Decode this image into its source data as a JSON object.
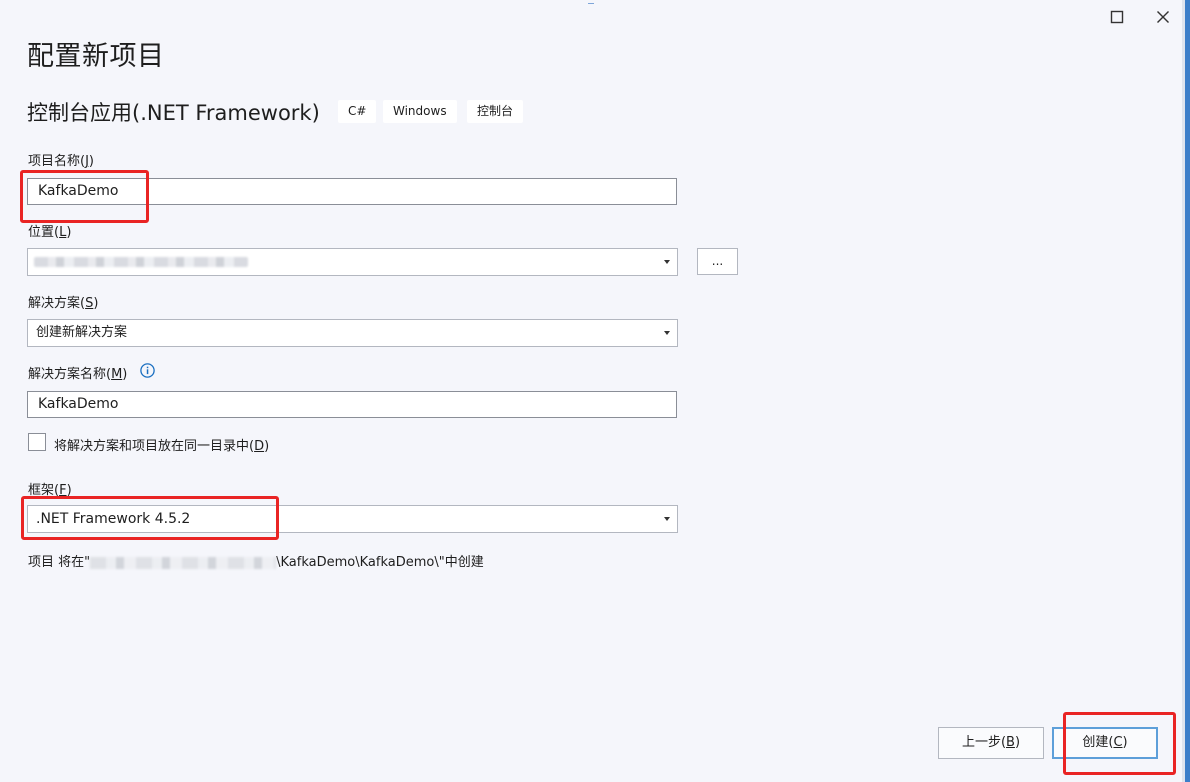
{
  "title": "配置新项目",
  "subtitle": "控制台应用(.NET Framework)",
  "tags": [
    "C#",
    "Windows",
    "控制台"
  ],
  "project_name": {
    "label": "项目名称(",
    "mnemonic": "J",
    "label_end": ")",
    "value": "KafkaDemo"
  },
  "location": {
    "label": "位置(",
    "mnemonic": "L",
    "label_end": ")",
    "browse_label": "..."
  },
  "solution": {
    "label": "解决方案(",
    "mnemonic": "S",
    "label_end": ")",
    "selected": "创建新解决方案"
  },
  "solution_name": {
    "label": "解决方案名称(",
    "mnemonic": "M",
    "label_end": ")",
    "value": "KafkaDemo"
  },
  "same_dir": {
    "label": "将解决方案和项目放在同一目录中(",
    "mnemonic": "D",
    "label_end": ")",
    "checked": false
  },
  "framework": {
    "label": "框架(",
    "mnemonic": "F",
    "label_end": ")",
    "selected": ".NET Framework 4.5.2"
  },
  "path_note": {
    "prefix": "项目 将在\"",
    "suffix": "\\KafkaDemo\\KafkaDemo\\\"中创建"
  },
  "buttons": {
    "back": {
      "label": "上一步(",
      "mnemonic": "B",
      "label_end": ")"
    },
    "create": {
      "label": "创建(",
      "mnemonic": "C",
      "label_end": ")"
    }
  },
  "colors": {
    "highlight": "#e92424",
    "accent": "#3c7ec9",
    "background": "#f5f6fb"
  }
}
